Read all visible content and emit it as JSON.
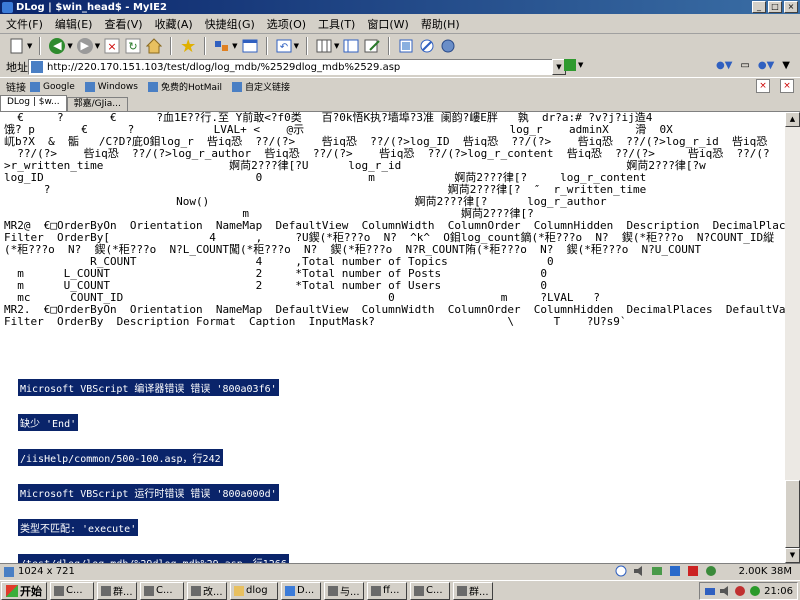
{
  "window": {
    "title": "DLog | $win_head$ - MyIE2"
  },
  "menu": [
    {
      "label": "文件(F)"
    },
    {
      "label": "编辑(E)"
    },
    {
      "label": "查看(V)"
    },
    {
      "label": "收藏(A)"
    },
    {
      "label": "快捷组(G)"
    },
    {
      "label": "选项(O)"
    },
    {
      "label": "工具(T)"
    },
    {
      "label": "窗口(W)"
    },
    {
      "label": "帮助(H)"
    }
  ],
  "address": {
    "label": "地址",
    "url": "http://220.170.151.103/test/dlog/log_mdb/%2529dlog_mdb%2529.asp"
  },
  "links": {
    "label": "链接",
    "items": [
      {
        "label": "Google"
      },
      {
        "label": "Windows"
      },
      {
        "label": "免费的HotMail"
      },
      {
        "label": "自定义链接"
      }
    ]
  },
  "tabs": [
    {
      "label": "DLog | $w..."
    },
    {
      "label": "郭嘉/GJia..."
    }
  ],
  "page": {
    "raw_lines": [
      "  €     ?       €      ?血1E??行.至 Y前敢<?f0类   百?0k悟K执?墙埠?3准 阑韵?嶁E胖   孰  dr?a:# ?v?j?ij造4",
      "饿? p       €      ?            LVAL+ <    @示                               log_r    adminX    滑  0X",
      "屼b?X  &  骺   /C?D?庛O鉬log_r  呰iq恐  ??/(?>    呰iq恐  ??/(?>log_ID  呰iq恐  ??/(?>    呰iq恐  ??/(?>log_r_id  呰iq恐",
      "  ??/(?>    呰iq恐  ??/(?>log_r_author  呰iq恐  ??/(?>    呰iq恐  ??/(?>log_r_content  呰iq恐  ??/(?>     呰iq恐  ??/(?",
      ">r_written_time                   婀苘2???律[?U      log_r_id                                  婀苘2???律[?w",
      "log_ID                                0                m            婀苘2???律[?     log_r_content",
      "      ?                                                            婀苘2???律[?  ″  r_written_time",
      "                          Now()                               婀苘2???律[?      log_r_author",
      "                                    m                                婀苘2???律[?",
      "MR2@  €□OrderByOn  Orientation  NameMap  DefaultView  ColumnWidth  ColumnOrder  ColumnHidden  Description  DecimalPlaces  D",
      "Filter  OrderBy[               4      ,     ?U鍥(*秬???o  N?  ^k^  O鉬log_count鏑(*秬???o  N?  鍥(*秬???o  N?COUNT_ID縦",
      "(*秬???o  N?  鍥(*秬???o  N?L_COUNT闖(*秬???o  N?  鍥(*秬???o  N?R_COUNT陏(*秬???o  N?  鍥(*秬???o  N?U_COUNT",
      "             R_COUNT                  4     ,Total number of Topics               0",
      "  m      L_COUNT                      2     *Total number of Posts               0",
      "  m      U_COUNT                      2     *Total number of Users               0",
      "  mc      COUNT_ID                                        0                m     ?LVAL   ?",
      "MR2.  €□OrderByOn  Orientation  NameMap  DefaultView  ColumnWidth  ColumnOrder  ColumnHidden  DecimalPlaces  DefaultValue",
      "Filter  OrderBy  Description Format  Caption  InputMask?                    \\      T    ?U?s9`"
    ],
    "errors": [
      "Microsoft VBScript 编译器错误 错误 '800a03f6'",
      "缺少 'End'",
      "/iisHelp/common/500-100.asp，行242",
      "Microsoft VBScript 运行时错误 错误 '800a000d'",
      "类型不匹配: 'execute'",
      "/test/dlog/log_mdb/%29dlog_mdb%29.asp，行1266"
    ]
  },
  "status": {
    "text": "1024 x 721",
    "speed": "2.00K 38M"
  },
  "taskbar": {
    "start_label": "开始",
    "buttons": [
      {
        "label": "C..."
      },
      {
        "label": "群..."
      },
      {
        "label": "C..."
      },
      {
        "label": "改..."
      },
      {
        "label": "dlog"
      },
      {
        "label": "D..."
      },
      {
        "label": "与..."
      },
      {
        "label": "ff..."
      },
      {
        "label": "C..."
      },
      {
        "label": "群..."
      }
    ],
    "clock": "21:06"
  }
}
